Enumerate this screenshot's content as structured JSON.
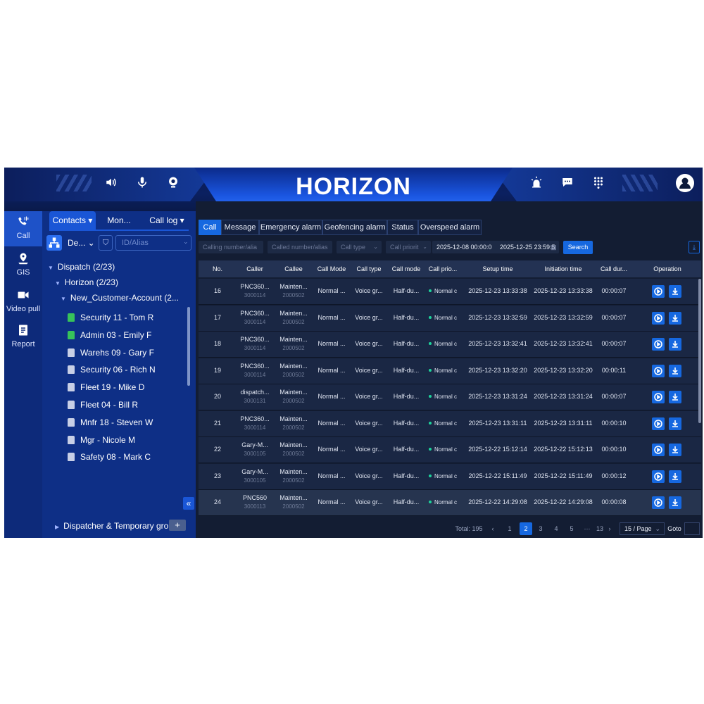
{
  "app": {
    "title": "HORIZON"
  },
  "header": {
    "left_icons": [
      "speaker-icon",
      "microphone-icon",
      "webcam-icon"
    ],
    "right_icons": [
      "alarm-icon",
      "message-icon",
      "dialpad-icon",
      "user-avatar-icon"
    ]
  },
  "nav": {
    "items": [
      {
        "label": "Call",
        "icon": "call-icon",
        "active": true
      },
      {
        "label": "GIS",
        "icon": "location-icon",
        "active": false
      },
      {
        "label": "Video pull",
        "icon": "video-icon",
        "active": false
      },
      {
        "label": "Report",
        "icon": "report-icon",
        "active": false
      }
    ]
  },
  "contacts": {
    "tabs": [
      {
        "label": "Contacts ▾",
        "active": true
      },
      {
        "label": "Mon...",
        "active": false
      },
      {
        "label": "Call log ▾",
        "active": false
      }
    ],
    "dept_label": "De... ⌄",
    "search_placeholder": "ID/Alias",
    "tree": {
      "dispatch": "Dispatch (2/23)",
      "horizon": "Horizon (2/23)",
      "account": "New_Customer-Account (2..."
    },
    "members": [
      {
        "name": "Security 11 - Tom R",
        "online": true
      },
      {
        "name": "Admin 03 - Emily F",
        "online": true
      },
      {
        "name": "Warehs 09 - Gary F",
        "online": false
      },
      {
        "name": "Security 06 - Rich N",
        "online": false
      },
      {
        "name": "Fleet 19 - Mike D",
        "online": false
      },
      {
        "name": "Fleet 04 - Bill R",
        "online": false
      },
      {
        "name": "Mnfr 18 - Steven W",
        "online": false
      },
      {
        "name": "Mgr - Nicole M",
        "online": false
      },
      {
        "name": "Safety 08 - Mark C",
        "online": false
      }
    ],
    "collapse_label": "«",
    "dispatcher_group": "Dispatcher & Temporary group",
    "add_label": "+"
  },
  "main": {
    "tabs": [
      {
        "label": "Call",
        "active": true
      },
      {
        "label": "Message",
        "active": false
      },
      {
        "label": "Emergency alarm",
        "active": false
      },
      {
        "label": "Geofencing alarm",
        "active": false
      },
      {
        "label": "Status",
        "active": false
      },
      {
        "label": "Overspeed alarm",
        "active": false
      }
    ],
    "filters": {
      "calling_placeholder": "Calling number/alia",
      "called_placeholder": "Called number/alias",
      "call_type_placeholder": "Call type",
      "call_priority_placeholder": "Call priorit",
      "date_start": "2025-12-08 00:00:0",
      "date_end": "2025-12-25 23:59:5",
      "search_label": "Search"
    },
    "columns": [
      "No.",
      "Caller",
      "Callee",
      "Call Mode",
      "Call type",
      "Call mode",
      "Call prio...",
      "Setup time",
      "Initiation time",
      "Call dur...",
      "Operation"
    ],
    "rows": [
      {
        "no": "16",
        "caller": "PNC360...",
        "caller_id": "3000114",
        "callee": "Mainten...",
        "callee_id": "2000502",
        "call_mode": "Normal ...",
        "call_type": "Voice gr...",
        "mode": "Half-du...",
        "priority": "Normal c",
        "setup": "2025-12-23 13:33:38",
        "initiation": "2025-12-23 13:33:38",
        "duration": "00:00:07"
      },
      {
        "no": "17",
        "caller": "PNC360...",
        "caller_id": "3000114",
        "callee": "Mainten...",
        "callee_id": "2000502",
        "call_mode": "Normal ...",
        "call_type": "Voice gr...",
        "mode": "Half-du...",
        "priority": "Normal c",
        "setup": "2025-12-23 13:32:59",
        "initiation": "2025-12-23 13:32:59",
        "duration": "00:00:07"
      },
      {
        "no": "18",
        "caller": "PNC360...",
        "caller_id": "3000114",
        "callee": "Mainten...",
        "callee_id": "2000502",
        "call_mode": "Normal ...",
        "call_type": "Voice gr...",
        "mode": "Half-du...",
        "priority": "Normal c",
        "setup": "2025-12-23 13:32:41",
        "initiation": "2025-12-23 13:32:41",
        "duration": "00:00:07"
      },
      {
        "no": "19",
        "caller": "PNC360...",
        "caller_id": "3000114",
        "callee": "Mainten...",
        "callee_id": "2000502",
        "call_mode": "Normal ...",
        "call_type": "Voice gr...",
        "mode": "Half-du...",
        "priority": "Normal c",
        "setup": "2025-12-23 13:32:20",
        "initiation": "2025-12-23 13:32:20",
        "duration": "00:00:11"
      },
      {
        "no": "20",
        "caller": "dispatch...",
        "caller_id": "3000131",
        "callee": "Mainten...",
        "callee_id": "2000502",
        "call_mode": "Normal ...",
        "call_type": "Voice gr...",
        "mode": "Half-du...",
        "priority": "Normal c",
        "setup": "2025-12-23 13:31:24",
        "initiation": "2025-12-23 13:31:24",
        "duration": "00:00:07"
      },
      {
        "no": "21",
        "caller": "PNC360...",
        "caller_id": "3000114",
        "callee": "Mainten...",
        "callee_id": "2000502",
        "call_mode": "Normal ...",
        "call_type": "Voice gr...",
        "mode": "Half-du...",
        "priority": "Normal c",
        "setup": "2025-12-23 13:31:11",
        "initiation": "2025-12-23 13:31:11",
        "duration": "00:00:10"
      },
      {
        "no": "22",
        "caller": "Gary-M...",
        "caller_id": "3000105",
        "callee": "Mainten...",
        "callee_id": "2000502",
        "call_mode": "Normal ...",
        "call_type": "Voice gr...",
        "mode": "Half-du...",
        "priority": "Normal c",
        "setup": "2025-12-22 15:12:14",
        "initiation": "2025-12-22 15:12:13",
        "duration": "00:00:10"
      },
      {
        "no": "23",
        "caller": "Gary-M...",
        "caller_id": "3000105",
        "callee": "Mainten...",
        "callee_id": "2000502",
        "call_mode": "Normal ...",
        "call_type": "Voice gr...",
        "mode": "Half-du...",
        "priority": "Normal c",
        "setup": "2025-12-22 15:11:49",
        "initiation": "2025-12-22 15:11:49",
        "duration": "00:00:12"
      },
      {
        "no": "24",
        "caller": "PNC560",
        "caller_id": "3000113",
        "callee": "Mainten...",
        "callee_id": "2000502",
        "call_mode": "Normal ...",
        "call_type": "Voice gr...",
        "mode": "Half-du...",
        "priority": "Normal c",
        "setup": "2025-12-22 14:29:08",
        "initiation": "2025-12-22 14:29:08",
        "duration": "00:00:08"
      }
    ],
    "pagination": {
      "total": "Total: 195",
      "prev": "‹",
      "pages": [
        "1",
        "2",
        "3",
        "4",
        "5",
        "···",
        "13"
      ],
      "active_page": "2",
      "next": "›",
      "page_size": "15 / Page",
      "goto_label": "Goto"
    }
  },
  "colors": {
    "accent": "#1668e0",
    "nav_bg": "#0d2a7a",
    "panel_bg": "#0e2f86",
    "table_bg": "#131d33",
    "online_green": "#37c25a"
  }
}
